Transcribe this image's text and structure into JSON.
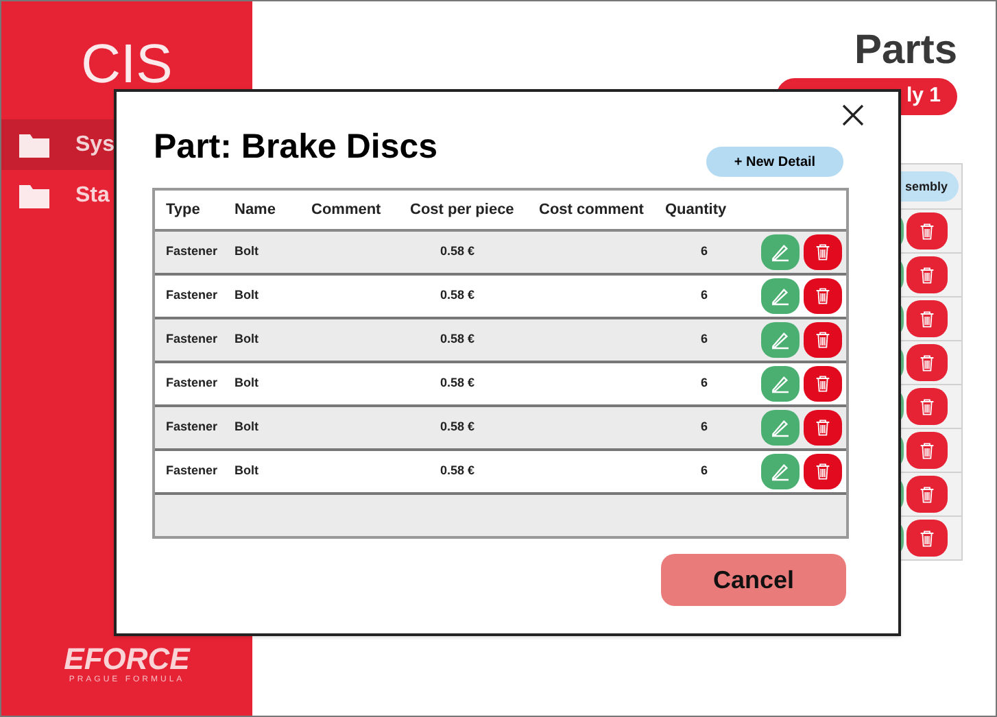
{
  "sidebar": {
    "title": "CIS",
    "items": [
      {
        "label": "Sys",
        "selected": true
      },
      {
        "label": "Sta",
        "selected": false
      }
    ],
    "logo": {
      "wordmark": "EFORCE",
      "tagline": "PRAGUE FORMULA"
    }
  },
  "main": {
    "title": "Parts",
    "filter_pill": "ly 1",
    "column_pill": "sembly"
  },
  "dialog": {
    "title": "Part: Brake Discs",
    "new_button": "+ New Detail",
    "columns": [
      "Type",
      "Name",
      "Comment",
      "Cost per piece",
      "Cost comment",
      "Quantity"
    ],
    "rows": [
      {
        "type": "Fastener",
        "name": "Bolt",
        "cost": "0.58 €",
        "quantity": "6"
      },
      {
        "type": "Fastener",
        "name": "Bolt",
        "cost": "0.58 €",
        "quantity": "6"
      },
      {
        "type": "Fastener",
        "name": "Bolt",
        "cost": "0.58 €",
        "quantity": "6"
      },
      {
        "type": "Fastener",
        "name": "Bolt",
        "cost": "0.58 €",
        "quantity": "6"
      },
      {
        "type": "Fastener",
        "name": "Bolt",
        "cost": "0.58 €",
        "quantity": "6"
      },
      {
        "type": "Fastener",
        "name": "Bolt",
        "cost": "0.58 €",
        "quantity": "6"
      }
    ],
    "cancel_button": "Cancel"
  }
}
